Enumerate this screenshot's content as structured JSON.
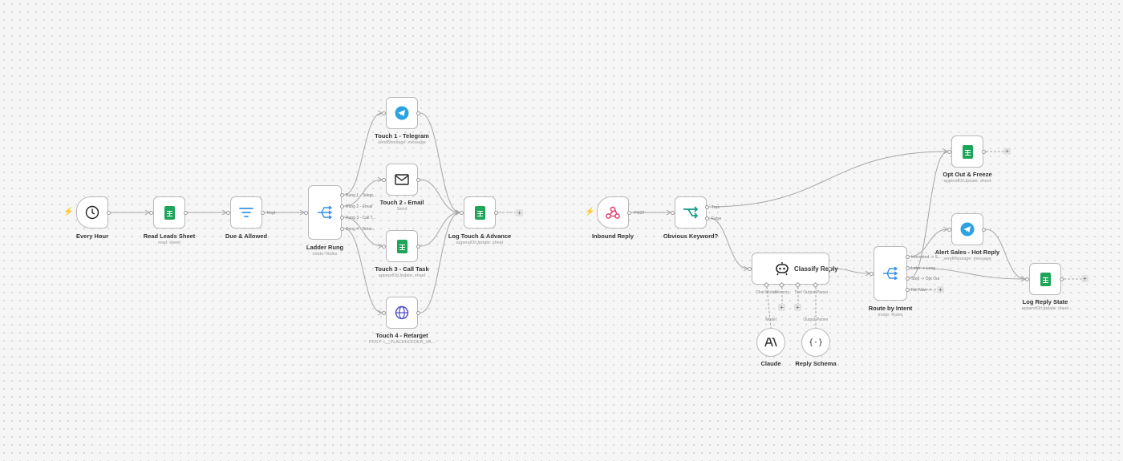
{
  "nodes": {
    "every_hour": {
      "label": "Every Hour",
      "sub": ""
    },
    "read_leads": {
      "label": "Read Leads Sheet",
      "sub": "read: sheet"
    },
    "due_allowed": {
      "label": "Due & Allowed",
      "sub": "",
      "out": "Kept"
    },
    "ladder_rung": {
      "label": "Ladder Rung",
      "sub": "mode: Rules",
      "outs": [
        "Rung 1 - Telegr...",
        "Rung 2 - Email",
        "Rung 3 - Call T...",
        "Rung 4 - Retar..."
      ]
    },
    "touch1": {
      "label": "Touch 1 - Telegram",
      "sub": "sendMessage: message"
    },
    "touch2": {
      "label": "Touch 2 - Email",
      "sub": "Send"
    },
    "touch3": {
      "label": "Touch 3 - Call Task",
      "sub": "appendOrUpdate: sheet"
    },
    "touch4": {
      "label": "Touch 4 - Retarget",
      "sub": "POST: <__PLACEHOLDER_VA..."
    },
    "log_touch": {
      "label": "Log Touch & Advance",
      "sub": "appendOrUpdate: sheet"
    },
    "inbound": {
      "label": "Inbound Reply",
      "sub": "",
      "out": "POST"
    },
    "obvious": {
      "label": "Obvious Keyword?",
      "sub": "",
      "outs": [
        "True",
        "False"
      ]
    },
    "classify": {
      "label": "Classify Reply",
      "inputs": [
        "Chat Model",
        "Memory",
        "Tool",
        "Output Parser"
      ]
    },
    "claude": {
      "label": "Claude",
      "conn": "Model"
    },
    "schema": {
      "label": "Reply Schema",
      "conn": "Output Parser"
    },
    "route": {
      "label": "Route by Intent",
      "sub": "mode: Rules",
      "outs": [
        "Interested -> S...",
        "Later -> Long ...",
        "Stop -> Opt Out",
        "Not Now -> ..."
      ]
    },
    "opt_out": {
      "label": "Opt Out & Freeze",
      "sub": "appendOrUpdate: sheet"
    },
    "alert": {
      "label": "Alert Sales - Hot Reply",
      "sub": "sendMessage: message"
    },
    "log_reply": {
      "label": "Log Reply State",
      "sub": "appendOrUpdate: sheet"
    }
  },
  "icons": {
    "every_hour": "clock-icon",
    "read_leads": "google-sheets-icon",
    "due_allowed": "filter-icon",
    "ladder_rung": "switch-icon",
    "touch1": "telegram-icon",
    "touch2": "mail-icon",
    "touch3": "google-sheets-icon",
    "touch4": "globe-icon",
    "log_touch": "google-sheets-icon",
    "inbound": "webhook-icon",
    "obvious": "if-branch-icon",
    "classify": "robot-icon",
    "claude": "anthropic-icon",
    "schema": "braces-icon",
    "route": "switch-icon",
    "opt_out": "google-sheets-icon",
    "alert": "telegram-icon",
    "log_reply": "google-sheets-icon"
  },
  "colors": {
    "edge": "#a6a6a6",
    "telegram": "#2aa3e0",
    "sheets": "#1ea55a",
    "webhook": "#e54773",
    "if_branch": "#129c84",
    "switch": "#3b92e8",
    "globe": "#4a49c9",
    "trigger_bolt": "#f27236"
  }
}
